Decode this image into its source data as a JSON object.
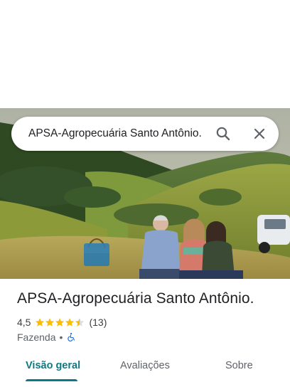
{
  "search": {
    "query": "APSA-Agropecuária Santo Antônio."
  },
  "place": {
    "title": "APSA-Agropecuária Santo Antônio.",
    "rating": "4,5",
    "stars_filled": 4.5,
    "review_count": "(13)",
    "category": "Fazenda",
    "separator": "•"
  },
  "tabs": [
    {
      "label": "Visão geral",
      "active": true
    },
    {
      "label": "Avaliações",
      "active": false
    },
    {
      "label": "Sobre",
      "active": false
    }
  ],
  "colors": {
    "accent": "#0b7a83",
    "star": "#fbbc04",
    "star_empty": "#dadce0"
  },
  "icons": {
    "search": "search-icon",
    "close": "close-icon",
    "accessibility": "wheelchair-accessible-icon"
  }
}
